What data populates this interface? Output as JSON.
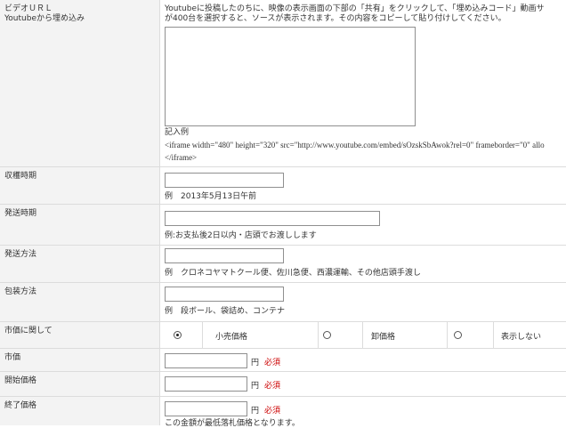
{
  "video": {
    "label_line1": "ビデオＵＲＬ",
    "label_line2": "Youtubeから埋め込み",
    "desc_line1": "Youtubeに投稿したのちに、映像の表示画面の下部の「共有」をクリックして、「埋め込みコード」動画サ",
    "desc_line2": "が400台を選択すると、ソースが表示されます。その内容をコピーして貼り付けしてください。",
    "example_title": "記入例",
    "example_line1": "<iframe width=\"480\" height=\"320\" src=\"http://www.youtube.com/embed/sOzskSbAwok?rel=0\" frameborder=\"0\" allo",
    "example_line2": "</iframe>"
  },
  "harvest": {
    "label": "収穫時期",
    "hint": "例　2013年5月13日午前"
  },
  "shipping_time": {
    "label": "発送時期",
    "hint": "例:お支払後2日以内・店頭でお渡しします"
  },
  "shipping_method": {
    "label": "発送方法",
    "hint": "例　クロネコヤマトクール便、佐川急便、西濃運輸、その他店頭手渡し"
  },
  "packaging": {
    "label": "包装方法",
    "hint": "例　段ボール、袋詰め、コンテナ"
  },
  "market": {
    "label": "市価に関して",
    "options": [
      {
        "label": "小売価格",
        "selected": true
      },
      {
        "label": "卸価格",
        "selected": false
      },
      {
        "label": "表示しない",
        "selected": false
      }
    ]
  },
  "market_price": {
    "label": "市価",
    "unit": "円",
    "required": "必須"
  },
  "start_price": {
    "label": "開始価格",
    "unit": "円",
    "required": "必須"
  },
  "end_price": {
    "label": "終了価格",
    "unit": "円",
    "required": "必須",
    "note": "この金額が最低落札価格となります。"
  }
}
